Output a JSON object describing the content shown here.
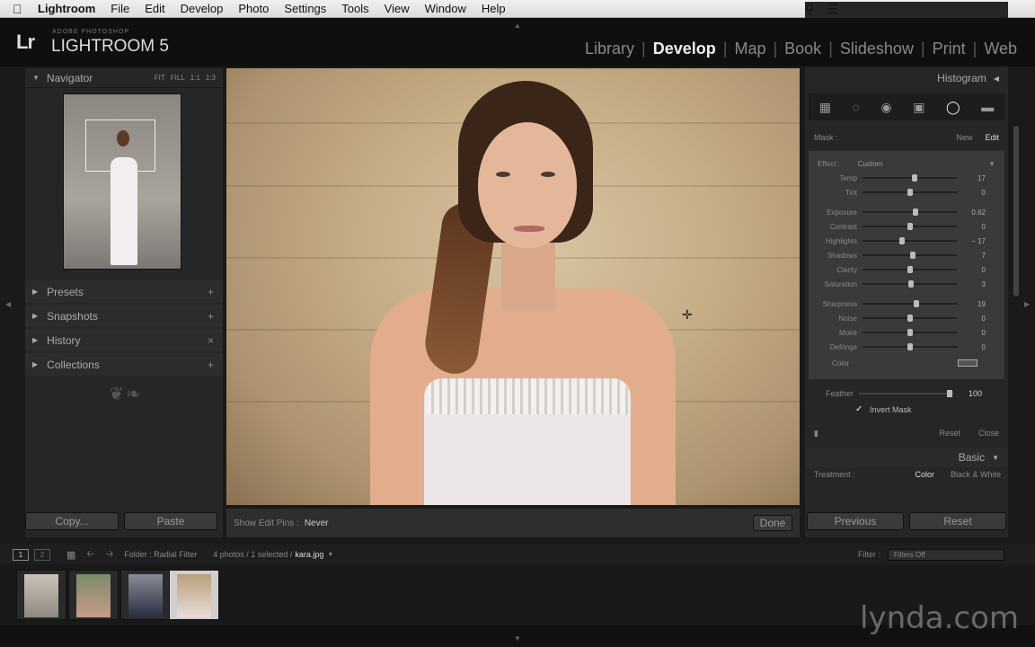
{
  "menubar": {
    "app": "Lightroom",
    "items": [
      "File",
      "Edit",
      "Develop",
      "Photo",
      "Settings",
      "Tools",
      "View",
      "Window",
      "Help"
    ]
  },
  "identity": {
    "logo": "Lr",
    "small": "ADOBE PHOTOSHOP",
    "big": "LIGHTROOM 5"
  },
  "modules": [
    "Library",
    "Develop",
    "Map",
    "Book",
    "Slideshow",
    "Print",
    "Web"
  ],
  "left": {
    "navigator_title": "Navigator",
    "nav_opts": [
      "FIT",
      "FILL",
      "1:1",
      "1:3"
    ],
    "sections": [
      {
        "label": "Presets",
        "icon": "+"
      },
      {
        "label": "Snapshots",
        "icon": "+"
      },
      {
        "label": "History",
        "icon": "×"
      },
      {
        "label": "Collections",
        "icon": "+"
      }
    ],
    "copy_label": "Copy...",
    "paste_label": "Paste"
  },
  "toolbar": {
    "show_pins_label": "Show Edit Pins :",
    "show_pins_value": "Never",
    "done_label": "Done"
  },
  "right": {
    "histogram_title": "Histogram",
    "mask_label": "Mask :",
    "mask_new": "New",
    "mask_edit": "Edit",
    "effect_label": "Effect :",
    "effect_value": "Custom",
    "adjustments": [
      {
        "label": "Temp",
        "value": "17",
        "pos": 0.55
      },
      {
        "label": "Tint",
        "value": "0",
        "pos": 0.5
      },
      {
        "label": "Exposure",
        "value": "0.62",
        "pos": 0.56
      },
      {
        "label": "Contrast",
        "value": "0",
        "pos": 0.5
      },
      {
        "label": "Highlights",
        "value": "− 17",
        "pos": 0.42
      },
      {
        "label": "Shadows",
        "value": "7",
        "pos": 0.53
      },
      {
        "label": "Clarity",
        "value": "0",
        "pos": 0.5
      },
      {
        "label": "Saturation",
        "value": "3",
        "pos": 0.51
      },
      {
        "label": "Sharpness",
        "value": "19",
        "pos": 0.57
      },
      {
        "label": "Noise",
        "value": "0",
        "pos": 0.5
      },
      {
        "label": "Moiré",
        "value": "0",
        "pos": 0.5
      },
      {
        "label": "Defringe",
        "value": "0",
        "pos": 0.5
      }
    ],
    "color_label": "Color",
    "feather_label": "Feather",
    "feather_value": "100",
    "invert_label": "Invert Mask",
    "reset_label": "Reset",
    "close_label": "Close",
    "basic_title": "Basic",
    "treatment_label": "Treatment :",
    "treatment_color": "Color",
    "treatment_bw": "Black & White",
    "previous_label": "Previous",
    "reset_btn_label": "Reset"
  },
  "filmstrip": {
    "screen1": "1",
    "screen2": "2",
    "folder_text": "Folder : Radial Filter",
    "count_text": "4 photos / 1 selected /",
    "selected_file": "kara.jpg",
    "filter_label": "Filter :",
    "filter_value": "Filters Off"
  },
  "watermark": "lynda.com"
}
